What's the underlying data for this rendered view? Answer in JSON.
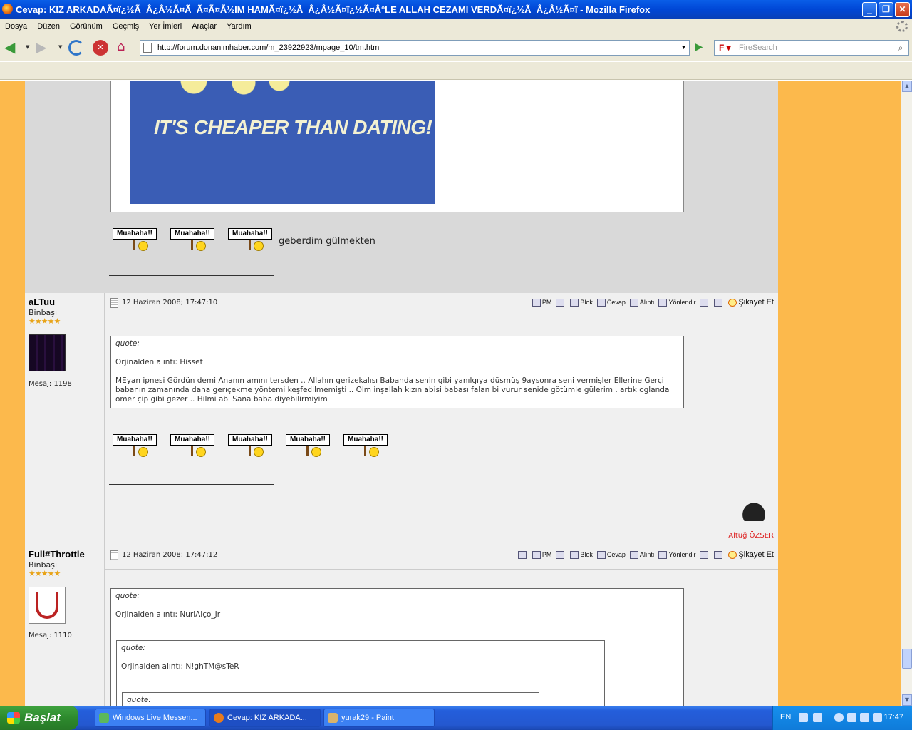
{
  "window": {
    "title": "Cevap: KIZ ARKADAÃ¤ï¿½Ã¯Â¿Â½Ã¤Ã¯Ã¤Ã¤Ã½IM HAMÃ¤ï¿½Ã¯Â¿Â½Ã¤ï¿½Ã¤Â°LE ALLAH CEZAMI VERDÃ¤ï¿½Ã¯Â¿Â½Ã¤ï - Mozilla Firefox",
    "minimize": "_",
    "maximize": "❐",
    "close": "✕"
  },
  "menu": [
    "Dosya",
    "Düzen",
    "Görünüm",
    "Geçmiş",
    "Yer İmleri",
    "Araçlar",
    "Yardım"
  ],
  "navbar": {
    "url": "http://forum.donanimhaber.com/m_23922923/mpage_10/tm.htm",
    "search_placeholder": "FireSearch",
    "search_engine_letter": "F"
  },
  "content": {
    "poster_text": "IT'S CHEAPER THAN DATING!",
    "smiley_label": "Muahaha!!",
    "post0_text": "geberdim gülmekten",
    "posts": [
      {
        "username": "aLTuu",
        "rank": "Binbaşı",
        "stars": "★★★★★",
        "messages": "Mesaj: 1198",
        "date": "12 Haziran 2008; 17:47:10",
        "quote_header": "quote:",
        "quote_source": "Orjinalden alıntı: Hisset",
        "quote_body": "MEyan ipnesi Gördün demi Ananın amını tersden .. Allahın gerizekalısı Babanda senin gibi yanılgıya düşmüş 9aysonra seni vermişler Ellerine Gerçi babanın zamanında daha gerıçekme yöntemi keşfedilmemişti .. Olm inşallah kızın abisi babası falan bi vurur senide götümle gülerim . artık oglanda ömer çip gibi gezer .. Hilmi abi Sana baba diyebilirmiyim",
        "signature": "Altuğ ÖZSER"
      },
      {
        "username": "Full#Throttle",
        "rank": "Binbaşı",
        "stars": "★★★★★",
        "messages": "Mesaj: 1110",
        "date": "12 Haziran 2008; 17:47:12",
        "quote_header": "quote:",
        "quote_source": "Orjinalden alıntı: NuriAlço_Jr",
        "nested_header": "quote:",
        "nested_source": "Orjinalden alıntı: N!ghTM@sTeR",
        "nested2_header": "quote:"
      }
    ],
    "actions": {
      "pm": "PM",
      "blok": "Blok",
      "cevap": "Cevap",
      "alinti": "Alıntı",
      "yonlendir": "Yönlendir",
      "sikayet": "Şikayet Et"
    }
  },
  "taskbar": {
    "start": "Başlat",
    "tasks": [
      "Windows Live Messen...",
      "Cevap: KIZ ARKADA...",
      "yurak29 - Paint"
    ],
    "lang": "EN",
    "clock": "17:47"
  }
}
